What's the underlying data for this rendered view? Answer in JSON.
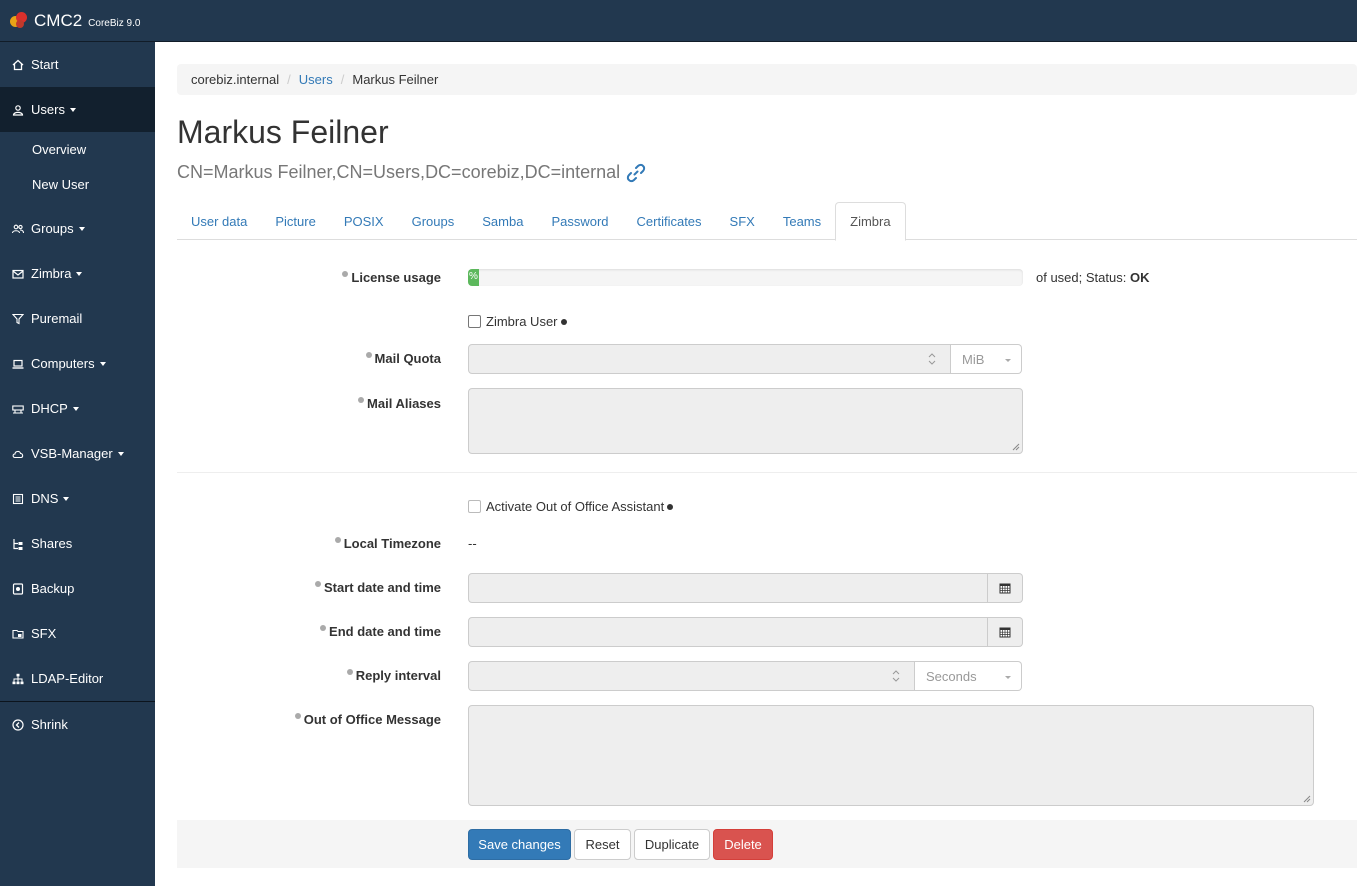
{
  "app": {
    "name": "CMC2",
    "version": "CoreBiz 9.0"
  },
  "sidebar": {
    "items": [
      {
        "label": "Start",
        "icon": "home-icon"
      },
      {
        "label": "Users",
        "icon": "user-icon",
        "active": true,
        "dropdown": true,
        "children": [
          {
            "label": "Overview"
          },
          {
            "label": "New User"
          }
        ]
      },
      {
        "label": "Groups",
        "icon": "group-icon",
        "dropdown": true
      },
      {
        "label": "Zimbra",
        "icon": "mail-icon",
        "dropdown": true
      },
      {
        "label": "Puremail",
        "icon": "filter-icon"
      },
      {
        "label": "Computers",
        "icon": "laptop-icon",
        "dropdown": true
      },
      {
        "label": "DHCP",
        "icon": "router-icon",
        "dropdown": true
      },
      {
        "label": "VSB-Manager",
        "icon": "cloud-icon",
        "dropdown": true
      },
      {
        "label": "DNS",
        "icon": "list-icon",
        "dropdown": true
      },
      {
        "label": "Shares",
        "icon": "tree-icon"
      },
      {
        "label": "Backup",
        "icon": "backup-icon"
      },
      {
        "label": "SFX",
        "icon": "sfx-icon"
      },
      {
        "label": "LDAP-Editor",
        "icon": "sitemap-icon"
      }
    ],
    "shrink": {
      "label": "Shrink",
      "icon": "shrink-icon"
    }
  },
  "breadcrumb": {
    "root": "corebiz.internal",
    "section": "Users",
    "current": "Markus Feilner"
  },
  "page": {
    "title": "Markus Feilner",
    "dn": "CN=Markus Feilner,CN=Users,DC=corebiz,DC=internal"
  },
  "tabs": [
    "User data",
    "Picture",
    "POSIX",
    "Groups",
    "Samba",
    "Password",
    "Certificates",
    "SFX",
    "Teams",
    "Zimbra"
  ],
  "active_tab": "Zimbra",
  "form": {
    "license_usage": {
      "label": "License usage",
      "bar_text": "%",
      "progress": 0,
      "status_prefix": "of used; Status:",
      "status": "OK"
    },
    "zimbra_user": {
      "label": "Zimbra User",
      "checked": false
    },
    "mail_quota": {
      "label": "Mail Quota",
      "value": "",
      "unit": "MiB"
    },
    "mail_aliases": {
      "label": "Mail Aliases",
      "value": ""
    },
    "out_of_office": {
      "label": "Activate Out of Office Assistant",
      "checked": false
    },
    "local_timezone": {
      "label": "Local Timezone",
      "value": "--"
    },
    "start_date": {
      "label": "Start date and time",
      "value": ""
    },
    "end_date": {
      "label": "End date and time",
      "value": ""
    },
    "reply_interval": {
      "label": "Reply interval",
      "value": "",
      "unit": "Seconds"
    },
    "ooo_message": {
      "label": "Out of Office Message",
      "value": ""
    }
  },
  "buttons": {
    "save": "Save changes",
    "reset": "Reset",
    "duplicate": "Duplicate",
    "delete": "Delete"
  },
  "colors": {
    "sidebar": "#22384f",
    "primary": "#337ab7",
    "success": "#5cb85c",
    "danger": "#d9534f"
  }
}
